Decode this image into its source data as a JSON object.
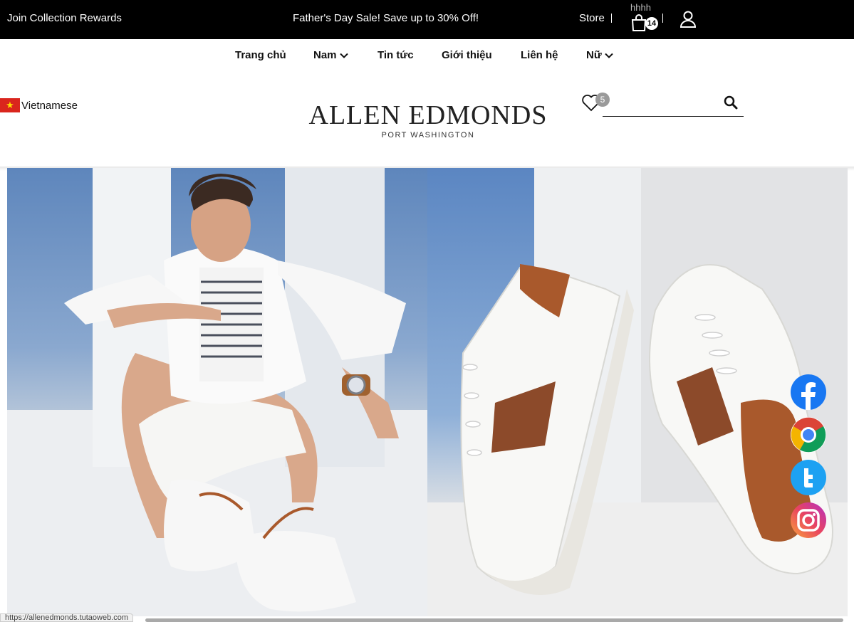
{
  "topbar": {
    "rewards_label": "Join Collection Rewards",
    "promo_text": "Father's Day Sale! Save up to 30% Off!",
    "store_label": "Store",
    "overflow_text": "hhhh",
    "cart_count": "14",
    "icons": {
      "cart": "shopping-bag-icon",
      "account": "user-icon"
    }
  },
  "nav": {
    "items": [
      {
        "label": "Trang chủ",
        "dropdown": false
      },
      {
        "label": "Nam",
        "dropdown": true
      },
      {
        "label": "Tin tức",
        "dropdown": false
      },
      {
        "label": "Giới thiệu",
        "dropdown": false
      },
      {
        "label": "Liên hệ",
        "dropdown": false
      },
      {
        "label": "Nữ",
        "dropdown": true
      }
    ]
  },
  "header": {
    "language_label": "Vietnamese",
    "logo_main": "ALLEN EDMONDS",
    "logo_sub": "PORT WASHINGTON",
    "wishlist_count": "5",
    "search": {
      "value": "",
      "placeholder": ""
    }
  },
  "hero": {
    "images": [
      "model-in-white-sitting",
      "white-leather-sneakers-with-woven-brown-panel"
    ]
  },
  "social": [
    {
      "name": "facebook",
      "color": "#1877f2"
    },
    {
      "name": "chrome",
      "color": "#4285f4"
    },
    {
      "name": "twitter",
      "color": "#1da1f2"
    },
    {
      "name": "instagram",
      "color": "#d6249f"
    }
  ],
  "status_bar": {
    "url": "https://allenedmonds.tutaoweb.com"
  },
  "colors": {
    "topbar_bg": "#000000",
    "accent_brown": "#a9592c"
  }
}
